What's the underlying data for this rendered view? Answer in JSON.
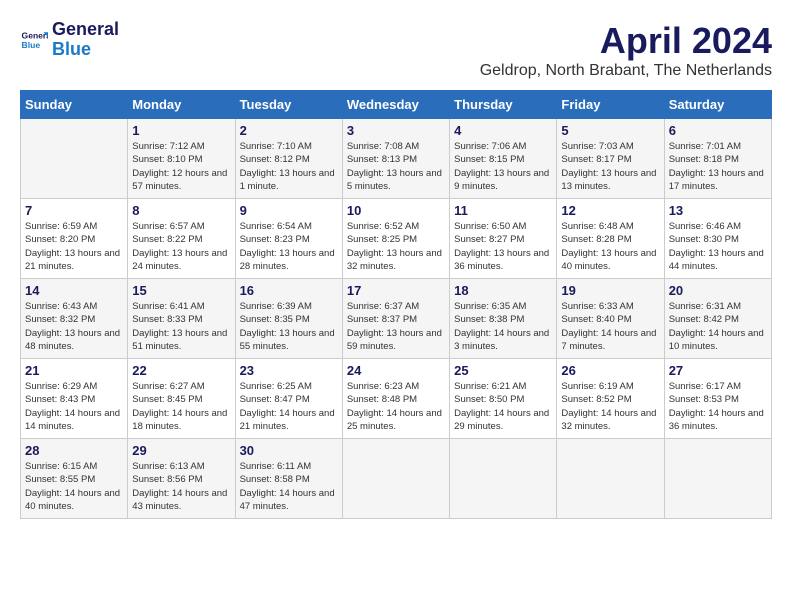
{
  "logo": {
    "line1": "General",
    "line2": "Blue"
  },
  "title": "April 2024",
  "subtitle": "Geldrop, North Brabant, The Netherlands",
  "weekdays": [
    "Sunday",
    "Monday",
    "Tuesday",
    "Wednesday",
    "Thursday",
    "Friday",
    "Saturday"
  ],
  "weeks": [
    [
      {
        "day": "",
        "sunrise": "",
        "sunset": "",
        "daylight": ""
      },
      {
        "day": "1",
        "sunrise": "Sunrise: 7:12 AM",
        "sunset": "Sunset: 8:10 PM",
        "daylight": "Daylight: 12 hours and 57 minutes."
      },
      {
        "day": "2",
        "sunrise": "Sunrise: 7:10 AM",
        "sunset": "Sunset: 8:12 PM",
        "daylight": "Daylight: 13 hours and 1 minute."
      },
      {
        "day": "3",
        "sunrise": "Sunrise: 7:08 AM",
        "sunset": "Sunset: 8:13 PM",
        "daylight": "Daylight: 13 hours and 5 minutes."
      },
      {
        "day": "4",
        "sunrise": "Sunrise: 7:06 AM",
        "sunset": "Sunset: 8:15 PM",
        "daylight": "Daylight: 13 hours and 9 minutes."
      },
      {
        "day": "5",
        "sunrise": "Sunrise: 7:03 AM",
        "sunset": "Sunset: 8:17 PM",
        "daylight": "Daylight: 13 hours and 13 minutes."
      },
      {
        "day": "6",
        "sunrise": "Sunrise: 7:01 AM",
        "sunset": "Sunset: 8:18 PM",
        "daylight": "Daylight: 13 hours and 17 minutes."
      }
    ],
    [
      {
        "day": "7",
        "sunrise": "Sunrise: 6:59 AM",
        "sunset": "Sunset: 8:20 PM",
        "daylight": "Daylight: 13 hours and 21 minutes."
      },
      {
        "day": "8",
        "sunrise": "Sunrise: 6:57 AM",
        "sunset": "Sunset: 8:22 PM",
        "daylight": "Daylight: 13 hours and 24 minutes."
      },
      {
        "day": "9",
        "sunrise": "Sunrise: 6:54 AM",
        "sunset": "Sunset: 8:23 PM",
        "daylight": "Daylight: 13 hours and 28 minutes."
      },
      {
        "day": "10",
        "sunrise": "Sunrise: 6:52 AM",
        "sunset": "Sunset: 8:25 PM",
        "daylight": "Daylight: 13 hours and 32 minutes."
      },
      {
        "day": "11",
        "sunrise": "Sunrise: 6:50 AM",
        "sunset": "Sunset: 8:27 PM",
        "daylight": "Daylight: 13 hours and 36 minutes."
      },
      {
        "day": "12",
        "sunrise": "Sunrise: 6:48 AM",
        "sunset": "Sunset: 8:28 PM",
        "daylight": "Daylight: 13 hours and 40 minutes."
      },
      {
        "day": "13",
        "sunrise": "Sunrise: 6:46 AM",
        "sunset": "Sunset: 8:30 PM",
        "daylight": "Daylight: 13 hours and 44 minutes."
      }
    ],
    [
      {
        "day": "14",
        "sunrise": "Sunrise: 6:43 AM",
        "sunset": "Sunset: 8:32 PM",
        "daylight": "Daylight: 13 hours and 48 minutes."
      },
      {
        "day": "15",
        "sunrise": "Sunrise: 6:41 AM",
        "sunset": "Sunset: 8:33 PM",
        "daylight": "Daylight: 13 hours and 51 minutes."
      },
      {
        "day": "16",
        "sunrise": "Sunrise: 6:39 AM",
        "sunset": "Sunset: 8:35 PM",
        "daylight": "Daylight: 13 hours and 55 minutes."
      },
      {
        "day": "17",
        "sunrise": "Sunrise: 6:37 AM",
        "sunset": "Sunset: 8:37 PM",
        "daylight": "Daylight: 13 hours and 59 minutes."
      },
      {
        "day": "18",
        "sunrise": "Sunrise: 6:35 AM",
        "sunset": "Sunset: 8:38 PM",
        "daylight": "Daylight: 14 hours and 3 minutes."
      },
      {
        "day": "19",
        "sunrise": "Sunrise: 6:33 AM",
        "sunset": "Sunset: 8:40 PM",
        "daylight": "Daylight: 14 hours and 7 minutes."
      },
      {
        "day": "20",
        "sunrise": "Sunrise: 6:31 AM",
        "sunset": "Sunset: 8:42 PM",
        "daylight": "Daylight: 14 hours and 10 minutes."
      }
    ],
    [
      {
        "day": "21",
        "sunrise": "Sunrise: 6:29 AM",
        "sunset": "Sunset: 8:43 PM",
        "daylight": "Daylight: 14 hours and 14 minutes."
      },
      {
        "day": "22",
        "sunrise": "Sunrise: 6:27 AM",
        "sunset": "Sunset: 8:45 PM",
        "daylight": "Daylight: 14 hours and 18 minutes."
      },
      {
        "day": "23",
        "sunrise": "Sunrise: 6:25 AM",
        "sunset": "Sunset: 8:47 PM",
        "daylight": "Daylight: 14 hours and 21 minutes."
      },
      {
        "day": "24",
        "sunrise": "Sunrise: 6:23 AM",
        "sunset": "Sunset: 8:48 PM",
        "daylight": "Daylight: 14 hours and 25 minutes."
      },
      {
        "day": "25",
        "sunrise": "Sunrise: 6:21 AM",
        "sunset": "Sunset: 8:50 PM",
        "daylight": "Daylight: 14 hours and 29 minutes."
      },
      {
        "day": "26",
        "sunrise": "Sunrise: 6:19 AM",
        "sunset": "Sunset: 8:52 PM",
        "daylight": "Daylight: 14 hours and 32 minutes."
      },
      {
        "day": "27",
        "sunrise": "Sunrise: 6:17 AM",
        "sunset": "Sunset: 8:53 PM",
        "daylight": "Daylight: 14 hours and 36 minutes."
      }
    ],
    [
      {
        "day": "28",
        "sunrise": "Sunrise: 6:15 AM",
        "sunset": "Sunset: 8:55 PM",
        "daylight": "Daylight: 14 hours and 40 minutes."
      },
      {
        "day": "29",
        "sunrise": "Sunrise: 6:13 AM",
        "sunset": "Sunset: 8:56 PM",
        "daylight": "Daylight: 14 hours and 43 minutes."
      },
      {
        "day": "30",
        "sunrise": "Sunrise: 6:11 AM",
        "sunset": "Sunset: 8:58 PM",
        "daylight": "Daylight: 14 hours and 47 minutes."
      },
      {
        "day": "",
        "sunrise": "",
        "sunset": "",
        "daylight": ""
      },
      {
        "day": "",
        "sunrise": "",
        "sunset": "",
        "daylight": ""
      },
      {
        "day": "",
        "sunrise": "",
        "sunset": "",
        "daylight": ""
      },
      {
        "day": "",
        "sunrise": "",
        "sunset": "",
        "daylight": ""
      }
    ]
  ]
}
